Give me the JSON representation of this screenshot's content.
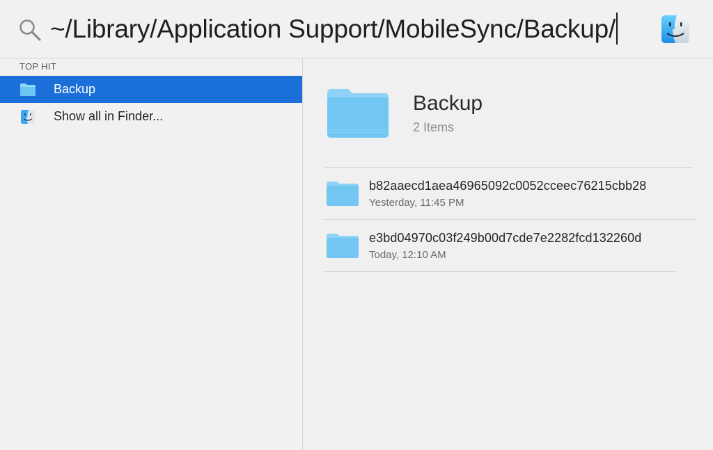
{
  "search": {
    "query": "~/Library/Application Support/MobileSync/Backup/"
  },
  "results": {
    "section_header": "TOP HIT",
    "items": [
      {
        "label": "Backup",
        "icon": "folder-icon",
        "selected": true
      },
      {
        "label": "Show all in Finder...",
        "icon": "finder-icon",
        "selected": false
      }
    ]
  },
  "preview": {
    "title": "Backup",
    "subtitle": "2 Items",
    "files": [
      {
        "name": "b82aaecd1aea46965092c0052cceec76215cbb28",
        "date": "Yesterday, 11:45 PM"
      },
      {
        "name": "e3bd04970c03f249b00d7cde7e2282fcd132260d",
        "date": "Today, 12:10 AM"
      }
    ]
  },
  "colors": {
    "selection": "#1a6fd8",
    "folder": "#6cc6f4"
  }
}
